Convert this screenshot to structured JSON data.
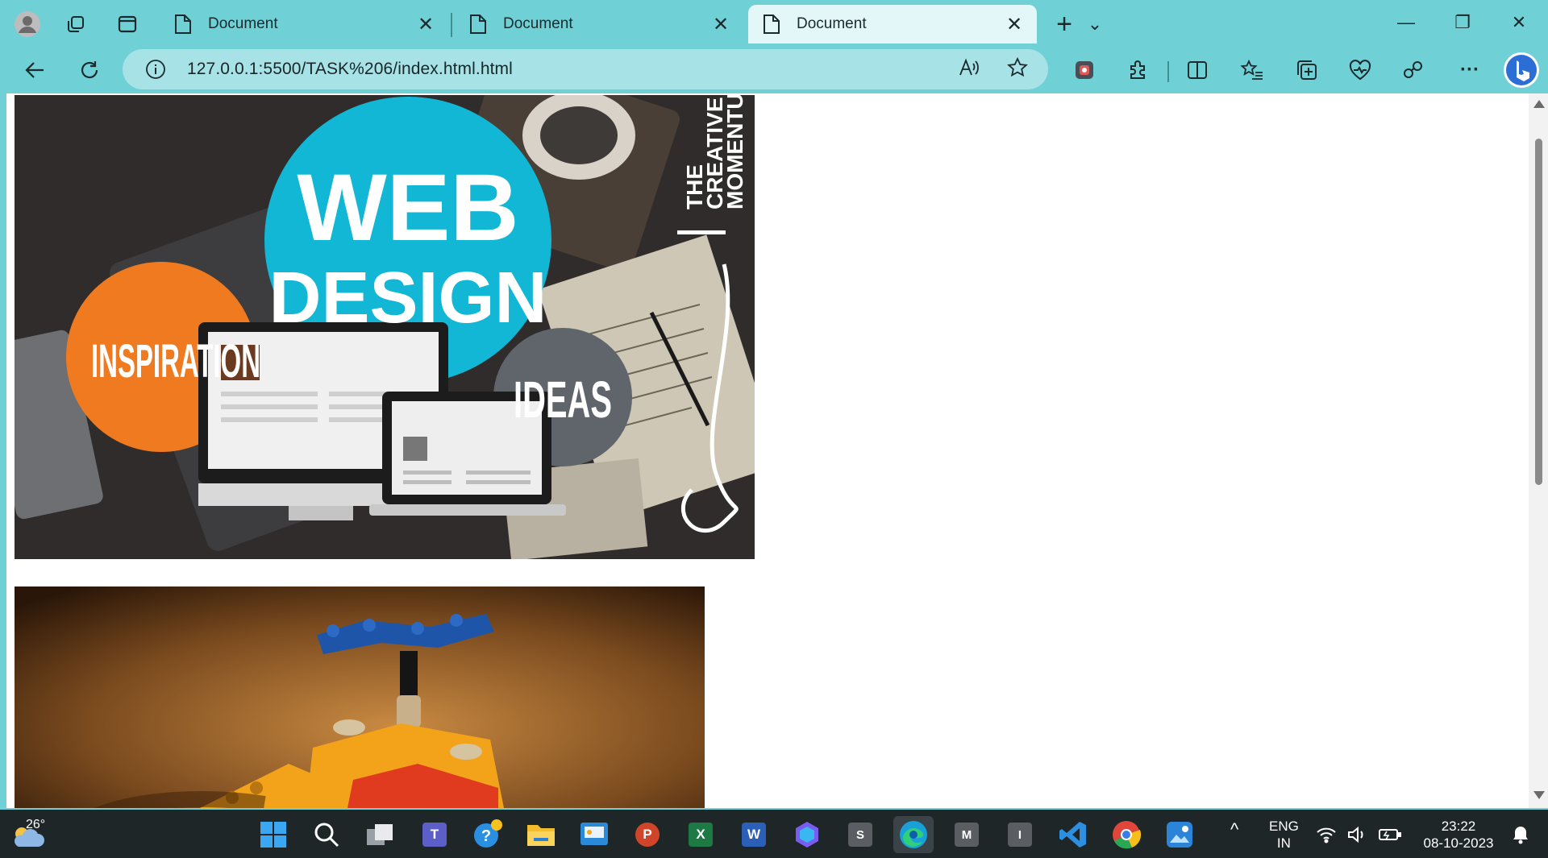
{
  "browser": {
    "tabs": [
      {
        "label": "Document",
        "close": "✕"
      },
      {
        "label": "Document",
        "close": "✕"
      },
      {
        "label": "Document",
        "close": "✕",
        "active": true
      }
    ],
    "new_tab": "+",
    "tab_menu": "⌄",
    "window": {
      "minimize": "—",
      "restore": "❐",
      "close": "✕"
    },
    "url": "127.0.0.1:5500/TASK%206/index.html.html",
    "more": "···"
  },
  "page": {
    "image1": {
      "headline_1": "WEB",
      "headline_2": "DESIGN",
      "circle_left": "INSPIRATION",
      "circle_right": "IDEAS",
      "vertical_1": "THE",
      "vertical_2": "CREATIVE",
      "vertical_3": "MOMENTUM"
    }
  },
  "taskbar": {
    "weather_temp": "26°",
    "apps": [
      "start-icon",
      "search-icon",
      "task-view-icon",
      "teams-icon",
      "help-icon",
      "file-explorer-icon",
      "news-icon",
      "powerpoint-icon",
      "excel-icon",
      "word-icon",
      "copilot-icon",
      "s-app-icon",
      "edge-icon",
      "m-app-icon",
      "i-app-icon",
      "vscode-icon",
      "chrome-icon",
      "photos-icon"
    ],
    "app_letters": {
      "powerpoint": "P",
      "excel": "X",
      "word": "W",
      "s_app": "S",
      "m_app": "M",
      "i_app": "I"
    },
    "language_1": "ENG",
    "language_2": "IN",
    "time": "23:22",
    "date": "08-10-2023",
    "chevron": "^"
  },
  "colors": {
    "chrome": "#6fd0d6",
    "omnibox": "#a6e2e6",
    "active_tab": "#e4f7f8",
    "taskbar": "#1f2628",
    "cyan_circle": "#11b7d4",
    "orange_circle": "#ef7a1f",
    "grey_circle": "#5f656a"
  }
}
